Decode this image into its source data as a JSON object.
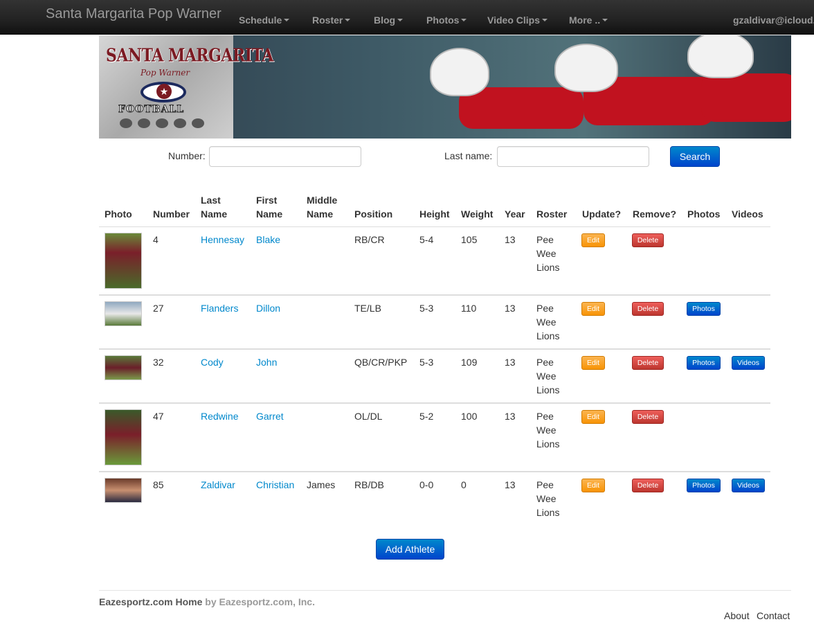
{
  "navbar": {
    "brand": "Santa Margarita Pop Warner",
    "menu": [
      "Schedule",
      "Roster",
      "Blog",
      "Photos",
      "Video Clips",
      "More .."
    ],
    "user": "gzaldivar@icloud."
  },
  "banner": {
    "logo_line1": "SANTA MARGARITA",
    "logo_line2": "Pop Warner",
    "logo_line3": "FOOTBALL"
  },
  "search": {
    "number_label": "Number:",
    "number_value": "",
    "lastname_label": "Last name:",
    "lastname_value": "",
    "button": "Search"
  },
  "table": {
    "headers": [
      "Photo",
      "Number",
      "Last Name",
      "First Name",
      "Middle Name",
      "Position",
      "Height",
      "Weight",
      "Year",
      "Roster",
      "Update?",
      "Remove?",
      "Photos",
      "Videos"
    ],
    "rows": [
      {
        "number": "4",
        "last": "Hennesay",
        "first": "Blake",
        "middle": "",
        "position": "RB/CR",
        "height": "5-4",
        "weight": "105",
        "year": "13",
        "roster": [
          "Pee",
          "Wee",
          "Lions"
        ],
        "edit": "Edit",
        "delete": "Delete",
        "photos": "",
        "videos": ""
      },
      {
        "number": "27",
        "last": "Flanders",
        "first": "Dillon",
        "middle": "",
        "position": "TE/LB",
        "height": "5-3",
        "weight": "110",
        "year": "13",
        "roster": [
          "Pee",
          "Wee",
          "Lions"
        ],
        "edit": "Edit",
        "delete": "Delete",
        "photos": "Photos",
        "videos": ""
      },
      {
        "number": "32",
        "last": "Cody",
        "first": "John",
        "middle": "",
        "position": "QB/CR/PKP",
        "height": "5-3",
        "weight": "109",
        "year": "13",
        "roster": [
          "Pee",
          "Wee",
          "Lions"
        ],
        "edit": "Edit",
        "delete": "Delete",
        "photos": "Photos",
        "videos": "Videos"
      },
      {
        "number": "47",
        "last": "Redwine",
        "first": "Garret",
        "middle": "",
        "position": "OL/DL",
        "height": "5-2",
        "weight": "100",
        "year": "13",
        "roster": [
          "Pee",
          "Wee",
          "Lions"
        ],
        "edit": "Edit",
        "delete": "Delete",
        "photos": "",
        "videos": ""
      },
      {
        "number": "85",
        "last": "Zaldivar",
        "first": "Christian",
        "middle": "James",
        "position": "RB/DB",
        "height": "0-0",
        "weight": "0",
        "year": "13",
        "roster": [
          "Pee",
          "Wee",
          "Lions"
        ],
        "edit": "Edit",
        "delete": "Delete",
        "photos": "Photos",
        "videos": "Videos"
      }
    ]
  },
  "add_button": "Add Athlete",
  "footer": {
    "home": "Eazesportz.com Home",
    "by": "by Eazesportz.com, Inc.",
    "about": "About",
    "contact": "Contact"
  },
  "colors": {
    "navbar": "#222222",
    "link": "#0088cc",
    "primary": "#0044cc",
    "warning": "#f89406",
    "danger": "#bd362f"
  }
}
